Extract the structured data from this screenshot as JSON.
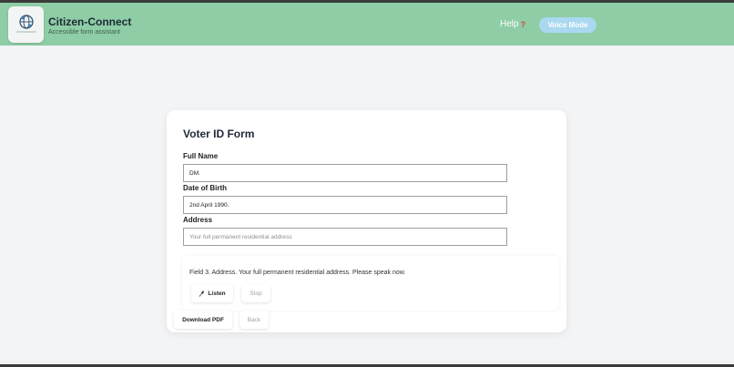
{
  "header": {
    "brand_title": "Citizen-Connect",
    "brand_subtitle": "Accessible form assistant",
    "logo_text": "Citizen Connect",
    "help_label": "Help",
    "help_icon": "question-mark-icon",
    "voice_mode_label": "Voice Mode",
    "colors": {
      "header_bg": "#8ecda6",
      "voice_btn_bg": "#a9d8f0"
    }
  },
  "form": {
    "title": "Voter ID Form",
    "fields": [
      {
        "label": "Full Name",
        "value": "DM.",
        "placeholder": ""
      },
      {
        "label": "Date of Birth",
        "value": "2nd April 1990.",
        "placeholder": ""
      },
      {
        "label": "Address",
        "value": "",
        "placeholder": "Your full permanent residential address"
      }
    ],
    "prompt_text": "Field 3. Address. Your full permanent residential address. Please speak now.",
    "listen_label": "Listen",
    "listen_icon": "microphone-icon",
    "stop_label": "Stop",
    "download_label": "Download PDF",
    "back_label": "Back"
  }
}
